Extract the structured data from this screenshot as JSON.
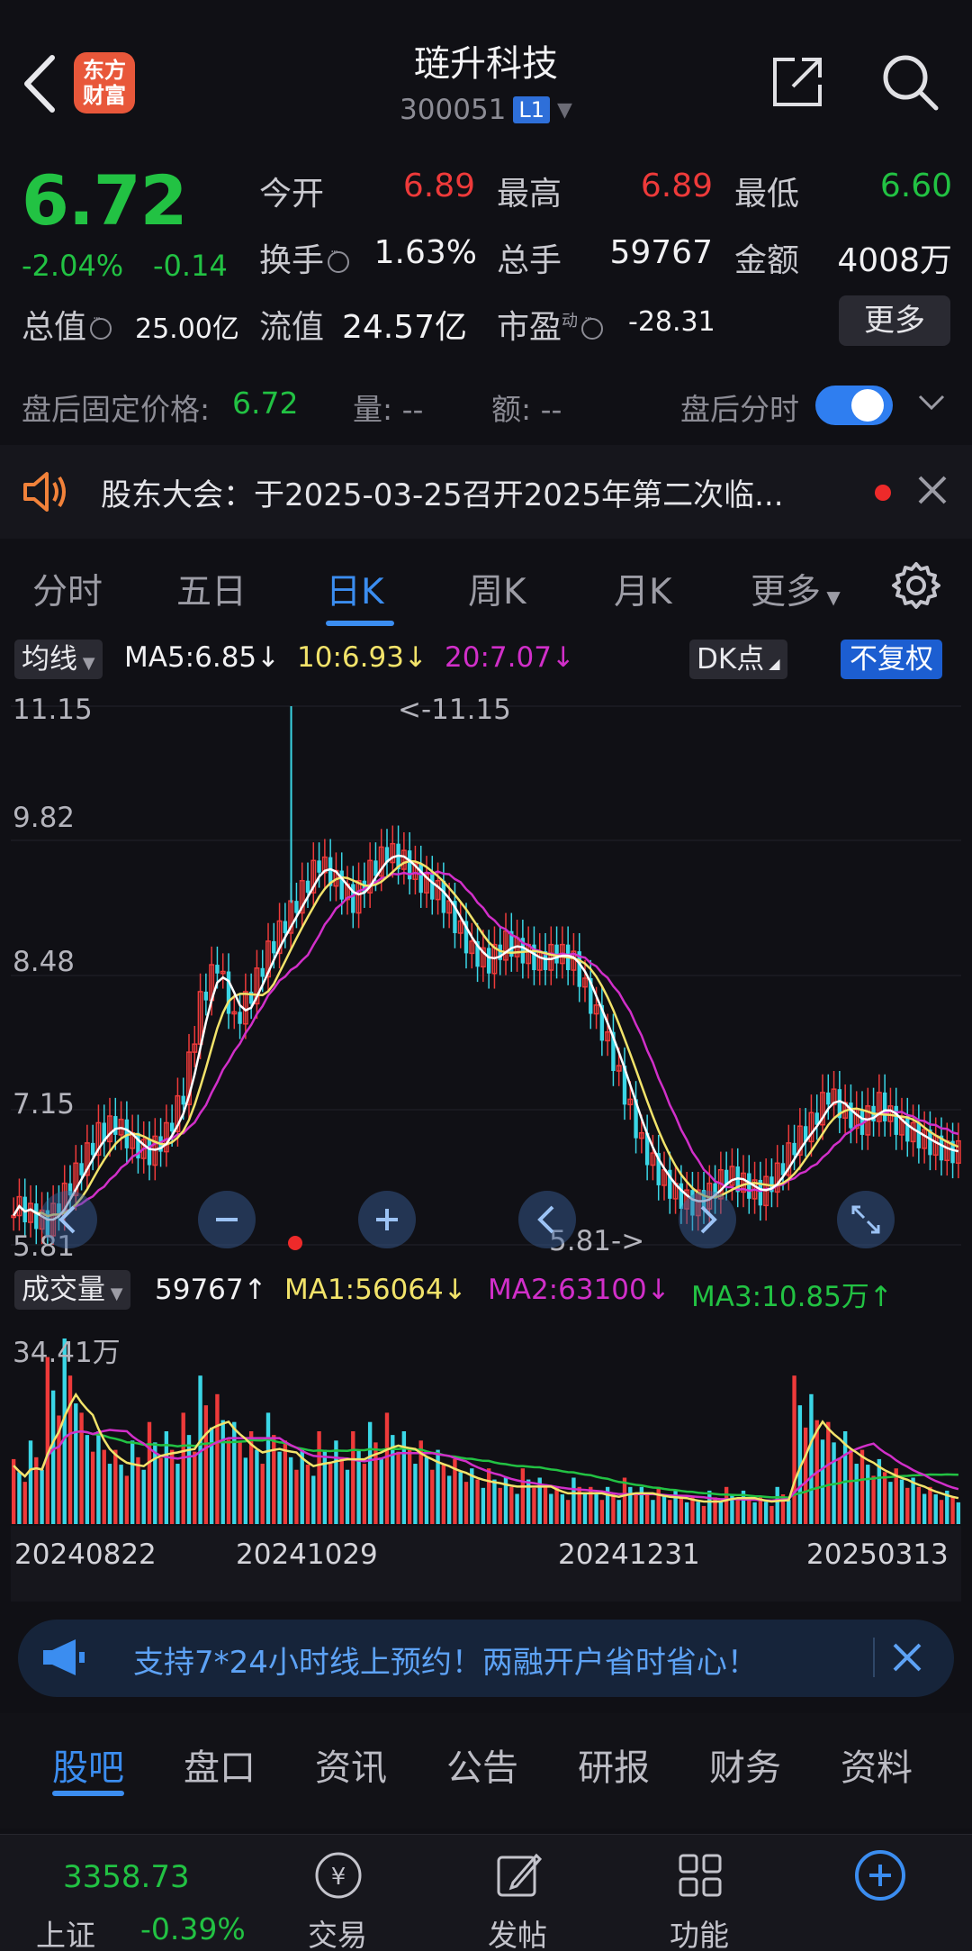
{
  "header": {
    "stock_name": "琏升科技",
    "stock_code": "300051",
    "level": "L1",
    "logo_text_line1": "东方",
    "logo_text_line2": "财富"
  },
  "quote": {
    "price": "6.72",
    "pct_change": "-2.04%",
    "abs_change": "-0.14",
    "open_label": "今开",
    "open": "6.89",
    "high_label": "最高",
    "high": "6.89",
    "low_label": "最低",
    "low": "6.60",
    "turnover_label": "换手",
    "turnover": "1.63%",
    "volume_label": "总手",
    "volume": "59767",
    "amount_label": "金额",
    "amount": "4008万",
    "mktcap_label": "总值",
    "mktcap": "25.00亿",
    "float_label": "流值",
    "float_cap": "24.57亿",
    "pe_label": "市盈",
    "pe_sup": "动",
    "pe": "-28.31",
    "more_label": "更多"
  },
  "after_hours": {
    "label": "盘后固定价格:",
    "price": "6.72",
    "vol": "量: --",
    "amt": "额: --",
    "time_label": "盘后分时",
    "toggle_on": true
  },
  "notice": {
    "text": "股东大会：于2025-03-25召开2025年第二次临..."
  },
  "chart_tabs": [
    "分时",
    "五日",
    "日K",
    "周K",
    "月K",
    "更多"
  ],
  "active_chart_tab": "日K",
  "ma_legend": {
    "selector": "均线",
    "ma5": "MA5:6.85↓",
    "ma10": "10:6.93↓",
    "ma20": "20:7.07↓",
    "dk": "DK点",
    "adjust": "不复权"
  },
  "kline": {
    "y_labels": [
      "11.15",
      "9.82",
      "8.48",
      "7.15",
      "5.81"
    ],
    "max_label": "<-11.15",
    "min_label": "5.81->"
  },
  "volume": {
    "selector": "成交量",
    "vol": "59767↑",
    "ma1": "MA1:56064↓",
    "ma2": "MA2:63100↓",
    "ma3": "MA3:10.85万↑",
    "max_label": "34.41万"
  },
  "dates": [
    "20240822",
    "20241029",
    "20241231",
    "20250313"
  ],
  "promo": {
    "text": "支持7*24小时线上预约！两融开户省时省心！"
  },
  "section_tabs": [
    "股吧",
    "盘口",
    "资讯",
    "公告",
    "研报",
    "财务",
    "资料"
  ],
  "active_section_tab": "股吧",
  "bottom_nav": {
    "index_value": "3358.73",
    "index_name": "上证",
    "index_change": "-0.39%",
    "items": [
      "交易",
      "发帖",
      "功能"
    ]
  },
  "colors": {
    "up": "#ee3a3a",
    "down": "#22c243",
    "accent": "#3b8df0",
    "candle_down": "#3ad6e6",
    "ma5": "#ffffff",
    "ma10": "#f2e36a",
    "ma20": "#d12fc9"
  },
  "chart_data": [
    {
      "type": "candlestick",
      "title": "",
      "ylim": [
        5.81,
        11.15
      ],
      "y_ticks": [
        11.15,
        9.82,
        8.48,
        7.15,
        5.81
      ],
      "x_ticks": [
        "20240822",
        "20241029",
        "20241231",
        "20250313"
      ],
      "series": [
        {
          "name": "MA5",
          "value_last": 6.85
        },
        {
          "name": "MA10",
          "value_last": 6.93
        },
        {
          "name": "MA20",
          "value_last": 7.07
        }
      ],
      "close_path": [
        6.2,
        6.1,
        6.0,
        6.3,
        6.6,
        6.9,
        7.0,
        6.8,
        6.7,
        6.9,
        7.3,
        8.2,
        8.6,
        8.0,
        8.3,
        8.7,
        9.0,
        9.3,
        9.6,
        9.4,
        9.2,
        9.5,
        9.7,
        9.6,
        9.4,
        9.3,
        9.0,
        8.7,
        8.6,
        8.8,
        8.7,
        8.6,
        8.7,
        8.6,
        8.2,
        7.8,
        7.3,
        6.8,
        6.5,
        6.3,
        6.2,
        6.3,
        6.5,
        6.4,
        6.3,
        6.5,
        6.8,
        7.0,
        7.3,
        7.1,
        7.0,
        7.2,
        7.0,
        6.9,
        6.8,
        6.72
      ],
      "max_value": 11.15,
      "min_value": 5.81
    },
    {
      "type": "bar",
      "title": "",
      "series_last": {
        "VOL": 59767,
        "MA1": 56064,
        "MA2": 63100,
        "MA3": 108500
      },
      "ylim": [
        0,
        344100
      ],
      "values_rel": [
        0.35,
        0.45,
        0.9,
        1.0,
        0.6,
        0.5,
        0.4,
        0.45,
        0.55,
        0.5,
        0.6,
        0.8,
        0.7,
        0.55,
        0.5,
        0.6,
        0.45,
        0.4,
        0.5,
        0.45,
        0.5,
        0.55,
        0.6,
        0.5,
        0.45,
        0.4,
        0.35,
        0.3,
        0.3,
        0.25,
        0.3,
        0.25,
        0.2,
        0.25,
        0.2,
        0.2,
        0.25,
        0.2,
        0.2,
        0.18,
        0.15,
        0.18,
        0.2,
        0.18,
        0.15,
        0.2,
        0.8,
        0.7,
        0.55,
        0.5,
        0.4,
        0.35,
        0.3,
        0.25,
        0.2,
        0.18
      ]
    }
  ]
}
